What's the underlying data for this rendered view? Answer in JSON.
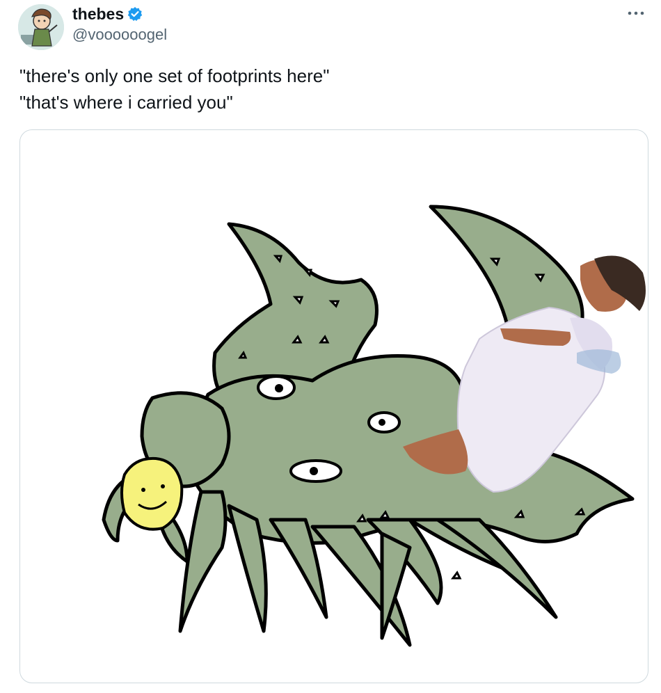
{
  "tweet": {
    "author": {
      "display_name": "thebes",
      "handle": "@voooooogel",
      "verified": true,
      "avatar_icon": "cartoon-avatar"
    },
    "more_icon": "more-horizontal-icon",
    "text_lines": [
      "\"there's only one set of footprints here\"",
      "\"that's where i carried you\""
    ],
    "media": {
      "type": "image",
      "icon": "octopus-meme-image"
    }
  },
  "colors": {
    "creature_green": "#98ad8c",
    "face_yellow": "#f6f27c",
    "verified_blue": "#1d9bf0",
    "robe_white": "#eeeaf4",
    "skin_brown": "#b06c4a"
  }
}
